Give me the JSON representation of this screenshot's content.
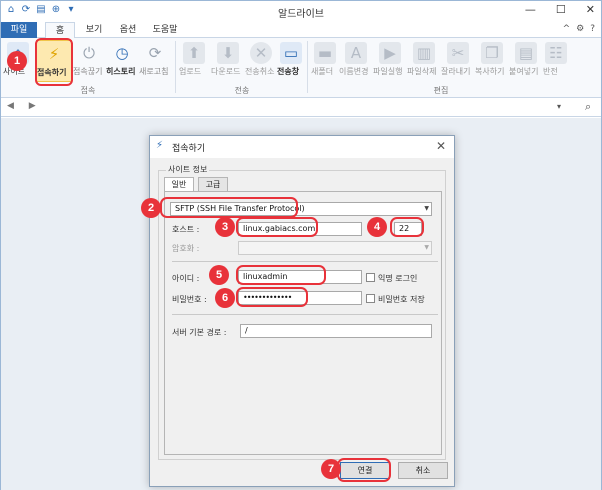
{
  "app": {
    "title": "알드라이브"
  },
  "quick_access": [
    "home-icon",
    "refresh-icon",
    "document-icon",
    "add-icon",
    "dropdown-icon"
  ],
  "window_controls": {
    "minimize": "—",
    "maximize": "☐",
    "close": "✕"
  },
  "tabs": [
    {
      "label": "파일"
    },
    {
      "label": "홈"
    },
    {
      "label": "보기"
    },
    {
      "label": "옵션"
    },
    {
      "label": "도움말"
    }
  ],
  "tab_right": {
    "collapse": "^",
    "settings": "⚙",
    "help": "?"
  },
  "ribbon": {
    "groups": [
      {
        "label": "접속"
      },
      {
        "label": "전송"
      },
      {
        "label": "편집"
      }
    ],
    "buttons": [
      {
        "label": "사이트",
        "icon": "site-icon"
      },
      {
        "label": "접속하기",
        "icon": "plug-icon"
      },
      {
        "label": "접속끊기",
        "icon": "unplug-icon"
      },
      {
        "label": "히스토리",
        "icon": "clock-icon"
      },
      {
        "label": "새로고침",
        "icon": "refresh-icon"
      },
      {
        "label": "업로드",
        "icon": "upload-icon"
      },
      {
        "label": "다운로드",
        "icon": "download-icon"
      },
      {
        "label": "전송취소",
        "icon": "cancel-icon"
      },
      {
        "label": "전송창",
        "icon": "window-icon"
      },
      {
        "label": "새폴더",
        "icon": "new-folder-icon"
      },
      {
        "label": "이름변경",
        "icon": "rename-icon"
      },
      {
        "label": "파일실행",
        "icon": "run-icon"
      },
      {
        "label": "파일삭제",
        "icon": "trash-icon"
      },
      {
        "label": "잘라내기",
        "icon": "scissors-icon"
      },
      {
        "label": "복사하기",
        "icon": "copy-icon"
      },
      {
        "label": "붙여넣기",
        "icon": "paste-icon"
      },
      {
        "label": "반전",
        "icon": "invert-icon"
      }
    ]
  },
  "address": {
    "nav": "◀ ▶",
    "dropdown": "▾",
    "search": "⌕"
  },
  "dialog": {
    "title": "접속하기",
    "close": "✕",
    "group_label": "사이트 정보",
    "tabs": [
      {
        "label": "일반"
      },
      {
        "label": "고급"
      }
    ],
    "protocol": "SFTP (SSH File Transfer Protocol)",
    "host_label": "호스트 :",
    "host_value": "linux.gabiacs.com",
    "port_value": "22",
    "encoding_label": "암호화 :",
    "id_label": "아이디 :",
    "id_value": "linuxadmin",
    "anon_label": "익명 로그인",
    "password_label": "비밀번호 :",
    "password_value": "•••••••••••••",
    "save_password_label": "비밀번호 저장",
    "path_label": "서버 기본 경로 :",
    "path_value": "/",
    "connect_button": "연결",
    "cancel_button": "취소"
  },
  "annotations": {
    "colors": {
      "badge": "#e8323a"
    },
    "badges": [
      "1",
      "2",
      "3",
      "4",
      "5",
      "6",
      "7"
    ]
  }
}
